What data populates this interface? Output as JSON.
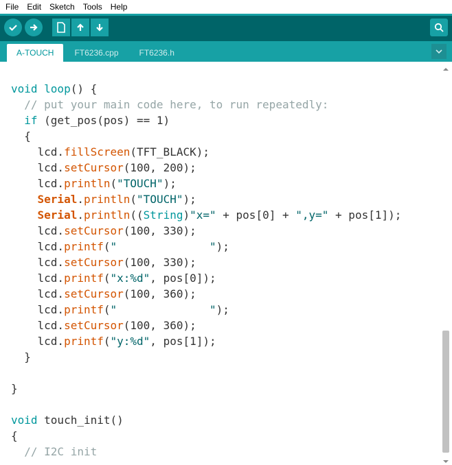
{
  "menu": {
    "items": [
      "File",
      "Edit",
      "Sketch",
      "Tools",
      "Help"
    ]
  },
  "toolbar": {
    "verify": "verify-icon",
    "upload": "upload-icon",
    "new": "new-icon",
    "open": "open-icon",
    "save": "save-icon",
    "serial": "serial-monitor-icon"
  },
  "tabs": {
    "items": [
      {
        "label": "A-TOUCH",
        "active": true
      },
      {
        "label": "FT6236.cpp",
        "active": false
      },
      {
        "label": "FT6236.h",
        "active": false
      }
    ]
  },
  "code": {
    "l0a": "void",
    "l0b": " loop",
    "l0c": "() {",
    "l1a": "  // put your main code here, to run repeatedly:",
    "l2a": "  ",
    "l2b": "if",
    "l2c": " (get_pos(pos) == 1)",
    "l3a": "  {",
    "l4a": "    lcd.",
    "l4b": "fillScreen",
    "l4c": "(TFT_BLACK);",
    "l5a": "    lcd.",
    "l5b": "setCursor",
    "l5c": "(100, 200);",
    "l6a": "    lcd.",
    "l6b": "println",
    "l6c": "(",
    "l6d": "\"TOUCH\"",
    "l6e": ");",
    "l7a": "    ",
    "l7b": "Serial",
    "l7c": ".",
    "l7d": "println",
    "l7e": "(",
    "l7f": "\"TOUCH\"",
    "l7g": ");",
    "l8a": "    ",
    "l8b": "Serial",
    "l8c": ".",
    "l8d": "println",
    "l8e": "((",
    "l8f": "String",
    "l8g": ")",
    "l8h": "\"x=\"",
    "l8i": " + pos[0] + ",
    "l8j": "\",y=\"",
    "l8k": " + pos[1]);",
    "l9a": "    lcd.",
    "l9b": "setCursor",
    "l9c": "(100, 330);",
    "l10a": "    lcd.",
    "l10b": "printf",
    "l10c": "(",
    "l10d": "\"              \"",
    "l10e": ");",
    "l11a": "    lcd.",
    "l11b": "setCursor",
    "l11c": "(100, 330);",
    "l12a": "    lcd.",
    "l12b": "printf",
    "l12c": "(",
    "l12d": "\"x:%d\"",
    "l12e": ", pos[0]);",
    "l13a": "    lcd.",
    "l13b": "setCursor",
    "l13c": "(100, 360);",
    "l14a": "    lcd.",
    "l14b": "printf",
    "l14c": "(",
    "l14d": "\"              \"",
    "l14e": ");",
    "l15a": "    lcd.",
    "l15b": "setCursor",
    "l15c": "(100, 360);",
    "l16a": "    lcd.",
    "l16b": "printf",
    "l16c": "(",
    "l16d": "\"y:%d\"",
    "l16e": ", pos[1]);",
    "l17a": "  }",
    "l18a": "",
    "l19a": "}",
    "l20a": "",
    "l21a": "void",
    "l21b": " touch_init()",
    "l22a": "{",
    "l23a": "  // I2C init"
  },
  "colors": {
    "toolbar": "#006468",
    "accent": "#17A1A5",
    "keyword": "#00979C",
    "function": "#D35400",
    "string": "#006468",
    "comment": "#95A5A6"
  }
}
